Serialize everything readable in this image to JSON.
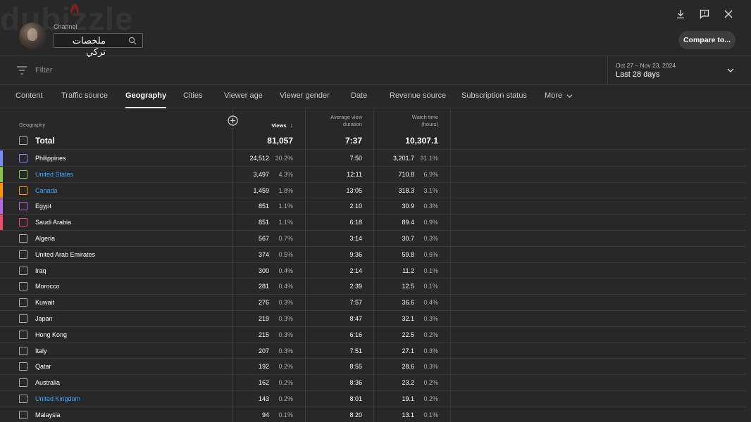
{
  "header": {
    "watermark": "dubizzle",
    "channel_label": "Channel",
    "channel_value": "ملخصات تركي",
    "compare_button": "Compare to..."
  },
  "filter": {
    "placeholder": "Filter",
    "date_range": "Oct 27 – Nov 23, 2024",
    "date_label": "Last 28 days"
  },
  "tabs": [
    {
      "label": "Content"
    },
    {
      "label": "Traffic source"
    },
    {
      "label": "Geography"
    },
    {
      "label": "Cities"
    },
    {
      "label": "Viewer age"
    },
    {
      "label": "Viewer gender"
    },
    {
      "label": "Date"
    },
    {
      "label": "Revenue source"
    },
    {
      "label": "Subscription status"
    },
    {
      "label": "More"
    }
  ],
  "table": {
    "headers": {
      "geography": "Geography",
      "views": "Views",
      "avd_line1": "Average view",
      "avd_line2": "duration",
      "wt_line1": "Watch time",
      "wt_line2": "(hours)"
    },
    "total": {
      "label": "Total",
      "views": "81,057",
      "avd": "7:37",
      "watch_time": "10,307.1"
    },
    "rows": [
      {
        "country": "Philippines",
        "views": "24,512",
        "views_pct": "30.2%",
        "avd": "7:50",
        "watch_time": "3,201.7",
        "wt_pct": "31.1%",
        "color": "#7b8cf0",
        "link": false
      },
      {
        "country": "United States",
        "views": "3,497",
        "views_pct": "4.3%",
        "avd": "12:11",
        "watch_time": "710.8",
        "wt_pct": "6.9%",
        "color": "#8bc34a",
        "link": true
      },
      {
        "country": "Canada",
        "views": "1,459",
        "views_pct": "1.8%",
        "avd": "13:05",
        "watch_time": "318.3",
        "wt_pct": "3.1%",
        "color": "#ff9800",
        "link": true
      },
      {
        "country": "Egypt",
        "views": "851",
        "views_pct": "1.1%",
        "avd": "2:10",
        "watch_time": "30.9",
        "wt_pct": "0.3%",
        "color": "#b36ae2",
        "link": false
      },
      {
        "country": "Saudi Arabia",
        "views": "851",
        "views_pct": "1.1%",
        "avd": "6:18",
        "watch_time": "89.4",
        "wt_pct": "0.9%",
        "color": "#e8506e",
        "link": false
      },
      {
        "country": "Algeria",
        "views": "567",
        "views_pct": "0.7%",
        "avd": "3:14",
        "watch_time": "30.7",
        "wt_pct": "0.3%",
        "color": "",
        "link": false
      },
      {
        "country": "United Arab Emirates",
        "views": "374",
        "views_pct": "0.5%",
        "avd": "9:36",
        "watch_time": "59.8",
        "wt_pct": "0.6%",
        "color": "",
        "link": false
      },
      {
        "country": "Iraq",
        "views": "300",
        "views_pct": "0.4%",
        "avd": "2:14",
        "watch_time": "11.2",
        "wt_pct": "0.1%",
        "color": "",
        "link": false
      },
      {
        "country": "Morocco",
        "views": "281",
        "views_pct": "0.4%",
        "avd": "2:39",
        "watch_time": "12.5",
        "wt_pct": "0.1%",
        "color": "",
        "link": false
      },
      {
        "country": "Kuwait",
        "views": "276",
        "views_pct": "0.3%",
        "avd": "7:57",
        "watch_time": "36.6",
        "wt_pct": "0.4%",
        "color": "",
        "link": false
      },
      {
        "country": "Japan",
        "views": "219",
        "views_pct": "0.3%",
        "avd": "8:47",
        "watch_time": "32.1",
        "wt_pct": "0.3%",
        "color": "",
        "link": false
      },
      {
        "country": "Hong Kong",
        "views": "215",
        "views_pct": "0.3%",
        "avd": "6:16",
        "watch_time": "22.5",
        "wt_pct": "0.2%",
        "color": "",
        "link": false
      },
      {
        "country": "Italy",
        "views": "207",
        "views_pct": "0.3%",
        "avd": "7:51",
        "watch_time": "27.1",
        "wt_pct": "0.3%",
        "color": "",
        "link": false
      },
      {
        "country": "Qatar",
        "views": "192",
        "views_pct": "0.2%",
        "avd": "8:55",
        "watch_time": "28.6",
        "wt_pct": "0.3%",
        "color": "",
        "link": false
      },
      {
        "country": "Australia",
        "views": "162",
        "views_pct": "0.2%",
        "avd": "8:36",
        "watch_time": "23.2",
        "wt_pct": "0.2%",
        "color": "",
        "link": false
      },
      {
        "country": "United Kingdom",
        "views": "143",
        "views_pct": "0.2%",
        "avd": "8:01",
        "watch_time": "19.1",
        "wt_pct": "0.2%",
        "color": "",
        "link": true
      },
      {
        "country": "Malaysia",
        "views": "94",
        "views_pct": "0.1%",
        "avd": "8:20",
        "watch_time": "13.1",
        "wt_pct": "0.1%",
        "color": "",
        "link": false
      }
    ]
  },
  "icons": {
    "download": "download-icon",
    "feedback": "feedback-icon",
    "close": "close-icon",
    "search": "search-icon",
    "filter": "filter-icon",
    "dropdown": "chevron-down-icon",
    "add_column": "add-column-icon",
    "sort": "sort-down-icon"
  },
  "colors": {
    "background": "#282828",
    "divider": "#3a3a3a",
    "link": "#3ea6ff"
  }
}
